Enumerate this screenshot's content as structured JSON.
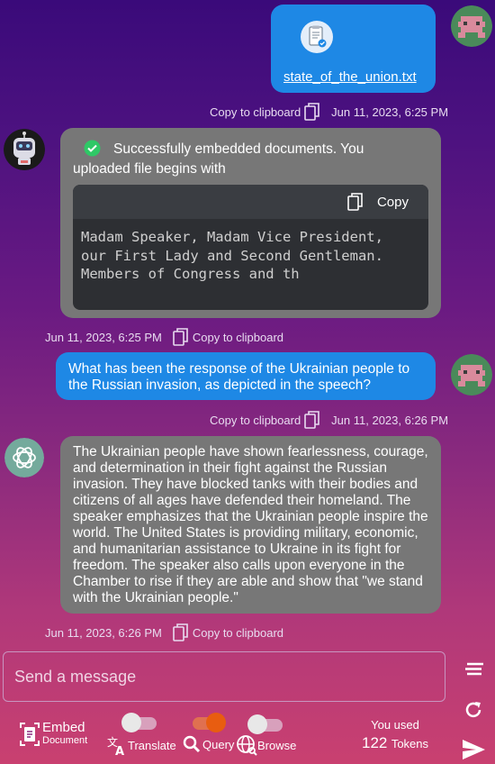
{
  "messages": {
    "m1": {
      "file_name": "state_of_the_union.txt",
      "copy_label": "Copy to clipboard",
      "timestamp": "Jun 11, 2023, 6:25 PM"
    },
    "m2": {
      "text": "Successfully embedded documents. You uploaded file begins with",
      "code_copy_label": "Copy",
      "code_lines": [
        "Madam Speaker, Madam Vice President,",
        "our First Lady and Second Gentleman.",
        "Members of Congress and th"
      ],
      "timestamp": "Jun 11, 2023, 6:25 PM",
      "copy_label": "Copy to clipboard"
    },
    "m3": {
      "text": "What has been the response of the Ukrainian people to the Russian invasion, as depicted in the speech?",
      "copy_label": "Copy to clipboard",
      "timestamp": "Jun 11, 2023, 6:26 PM"
    },
    "m4": {
      "text": "The Ukrainian people have shown fearlessness, courage, and determination in their fight against the Russian invasion. They have blocked tanks with their bodies and citizens of all ages have defended their homeland. The speaker emphasizes that the Ukrainian people inspire the world. The United States is providing military, economic, and humanitarian assistance to Ukraine in its fight for freedom. The speaker also calls upon everyone in the Chamber to rise if they are able and show that \"we stand with the Ukrainian people.\"",
      "timestamp": "Jun 11, 2023, 6:26 PM",
      "copy_label": "Copy to clipboard"
    }
  },
  "composer": {
    "placeholder": "Send a message",
    "embed_label": "Embed",
    "embed_sub": "Document",
    "translate_label": "Translate",
    "query_label": "Query",
    "browse_label": "Browse",
    "toggles": {
      "translate": false,
      "query": true,
      "browse": false
    },
    "usage_label": "You used",
    "token_count": "122",
    "token_unit": "Tokens"
  },
  "colors": {
    "user_bubble": "#1e88e5",
    "bot_bubble": "#777777",
    "toggle_on": "#e85d10"
  },
  "icons": [
    "user-avatar-icon",
    "robot-avatar-icon",
    "openai-avatar-icon",
    "file-icon",
    "copy-icon",
    "check-circle-icon",
    "clear-icon",
    "refresh-icon",
    "send-icon",
    "embed-icon",
    "translate-icon",
    "search-icon",
    "globe-icon"
  ]
}
